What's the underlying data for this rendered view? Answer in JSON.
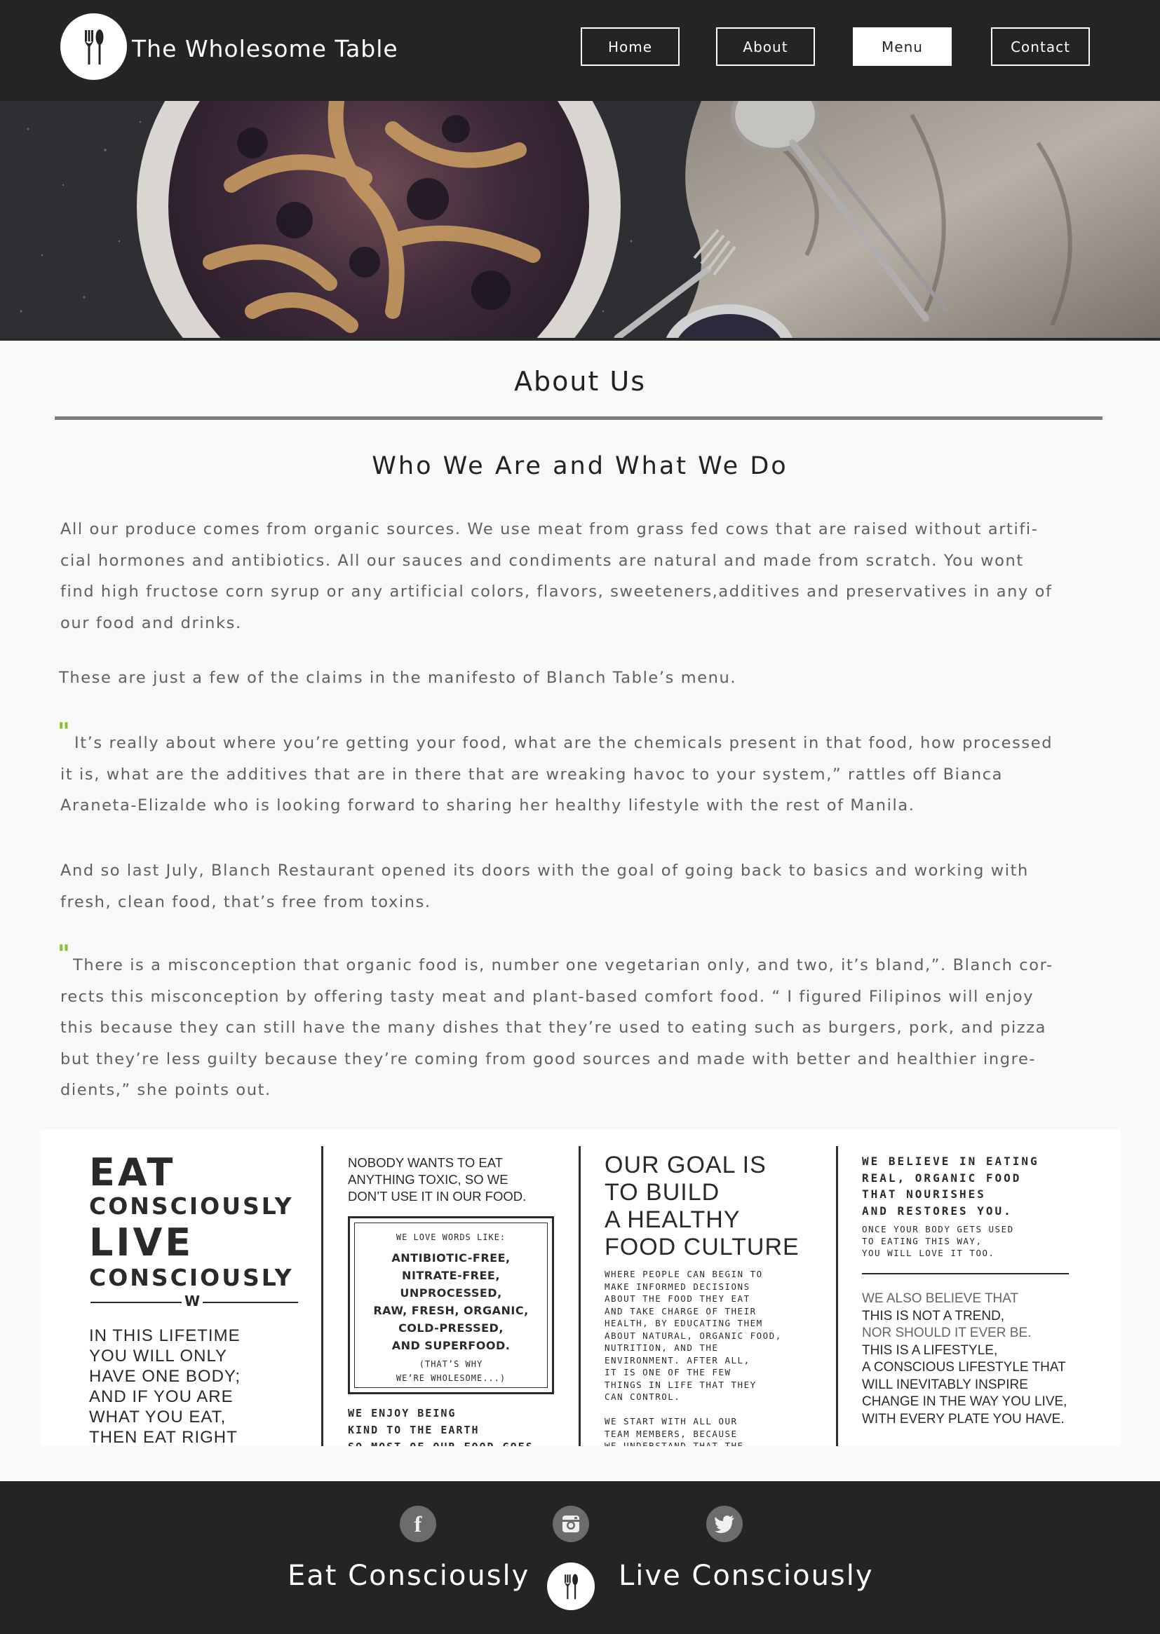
{
  "header": {
    "brand": "The Wholesome Table",
    "logo_icon": "fork-spoon-icon",
    "nav": [
      {
        "label": "Home",
        "active": false
      },
      {
        "label": "About",
        "active": false
      },
      {
        "label": "Menu",
        "active": true
      },
      {
        "label": "Contact",
        "active": false
      }
    ]
  },
  "hero": {
    "image": "blueberry-pie-photo"
  },
  "main": {
    "title": "About Us",
    "subtitle": "Who We Are and What We Do",
    "para1": "All our produce comes from organic sources. We use meat from grass fed cows that are raised without artificial hormones and antibiotics. All our sauces and condiments are natural and made from scratch. You wont find high fructose corn syrup or any artificial colors, flavors, sweeteners,additives and preservatives in any of our food and drinks.",
    "para1_lines": [
      "All our produce comes from organic sources. We use meat from grass fed cows that are raised without artifi-",
      "cial hormones and antibiotics. All our sauces and condiments are natural and made from scratch. You wont",
      "find high fructose corn syrup or any artificial colors, flavors, sweeteners,additives and preservatives in any of",
      "our food and drinks."
    ],
    "para2": "These are just a few of the claims in the manifesto of Blanch Table’s menu.",
    "quote_mark": "\"",
    "para3_lines": [
      "It’s really about where you’re getting your food, what are the chemicals present in that food, how processed",
      "it is, what are the additives that are in there that are wreaking havoc to your system,” rattles off Bianca",
      "Araneta-Elizalde who is looking forward to sharing her healthy lifestyle with the rest of Manila."
    ],
    "para4_lines": [
      "And so last July, Blanch Restaurant opened its doors with the goal of going back to basics and working with",
      "fresh, clean food, that’s free from toxins."
    ],
    "para5_lines": [
      "There is a misconception that organic food is, number one vegetarian only, and two, it’s bland,”. Blanch cor-",
      "rects this misconception by offering tasty meat and plant-based comfort food. “ I figured Filipinos will enjoy",
      "this because they can still have the many dishes that they’re used to eating such as burgers, pork, and pizza",
      "but they’re less guilty because they’re coming from good sources and made with better and healthier ingre-",
      "dients,” she points out."
    ]
  },
  "poster": {
    "col1": {
      "eat": "EAT",
      "consciously1": "CONSCIOUSLY",
      "live": "LIVE",
      "consciously2": "CONSCIOUSLY",
      "badge": "W",
      "lines": [
        "IN THIS LIFETIME",
        "YOU WILL ONLY",
        "HAVE ONE BODY;",
        "AND IF YOU ARE",
        "WHAT YOU EAT,",
        "THEN EAT RIGHT"
      ]
    },
    "col2": {
      "intro": [
        "NOBODY WANTS TO EAT",
        "ANYTHING TOXIC, SO WE",
        "DON’T USE IT IN OUR FOOD."
      ],
      "box_head": "WE LOVE WORDS LIKE:",
      "box_words": [
        "ANTIBIOTIC-FREE,",
        "NITRATE-FREE,",
        "UNPROCESSED,",
        "RAW, FRESH, ORGANIC,",
        "COLD-PRESSED,",
        "AND SUPERFOOD."
      ],
      "box_foot": [
        "(THAT’S WHY",
        "WE’RE WHOLESOME...)"
      ],
      "outro": [
        "WE ENJOY BEING",
        "KIND TO THE EARTH",
        "SO MOST OF OUR FOOD GOES"
      ]
    },
    "col3": {
      "head": [
        "OUR GOAL IS",
        "TO BUILD",
        "A HEALTHY",
        "FOOD CULTURE"
      ],
      "body": [
        "WHERE PEOPLE CAN BEGIN TO",
        "MAKE INFORMED DECISIONS",
        "ABOUT THE FOOD THEY EAT",
        "AND TAKE CHARGE OF THEIR",
        "HEALTH, BY EDUCATING THEM",
        "ABOUT NATURAL, ORGANIC FOOD,",
        "NUTRITION, AND THE",
        "ENVIRONMENT. AFTER ALL,",
        "IT IS ONE OF THE FEW",
        "THINGS IN LIFE THAT THEY",
        "CAN CONTROL."
      ],
      "tail": [
        "WE START WITH ALL OUR",
        "TEAM MEMBERS, BECAUSE",
        "WE UNDERSTAND THAT THE"
      ]
    },
    "col4": {
      "head": [
        "WE BELIEVE IN EATING",
        "REAL, ORGANIC FOOD",
        "THAT NOURISHES",
        "AND RESTORES YOU."
      ],
      "sub": [
        "ONCE YOUR BODY GETS USED",
        "TO EATING THIS WAY,",
        "YOU WILL LOVE IT TOO."
      ],
      "body": [
        "WE ALSO BELIEVE THAT",
        "THIS IS NOT A TREND,",
        "NOR SHOULD IT EVER BE.",
        "THIS IS A LIFESTYLE,",
        "A CONSCIOUS LIFESTYLE THAT",
        "WILL INEVITABLY INSPIRE",
        "CHANGE IN THE WAY YOU LIVE,",
        "WITH EVERY PLATE YOU HAVE."
      ]
    }
  },
  "footer": {
    "social": [
      {
        "name": "facebook-icon",
        "glyph": "f"
      },
      {
        "name": "instagram-icon",
        "glyph": ""
      },
      {
        "name": "twitter-icon",
        "glyph": ""
      }
    ],
    "left_text": "Eat Consciously",
    "right_text": "Live Consciously"
  },
  "colors": {
    "header_bg": "#242424",
    "accent_quote": "#8bbf2f",
    "page_bg": "#f8f8f8"
  }
}
